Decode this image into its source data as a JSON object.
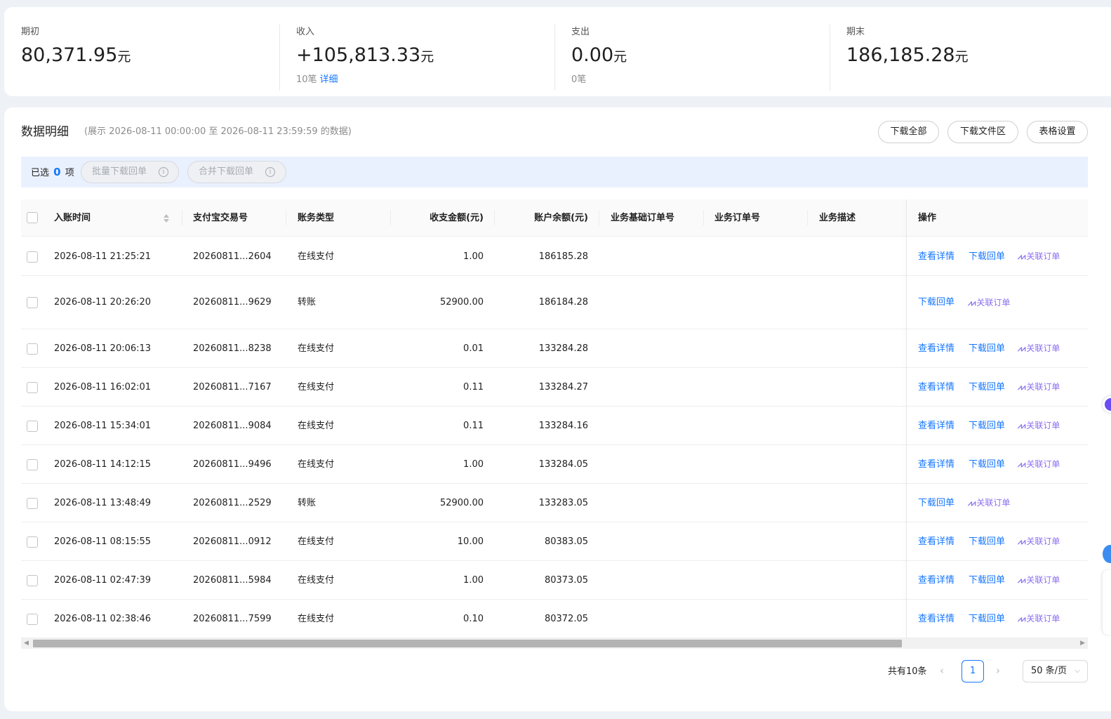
{
  "summary": {
    "opening": {
      "label": "期初",
      "value": "80,371.95",
      "unit": "元"
    },
    "income": {
      "label": "收入",
      "value": "+105,813.33",
      "unit": "元",
      "count": "10笔",
      "detail_link": "详细"
    },
    "expense": {
      "label": "支出",
      "value": "0.00",
      "unit": "元",
      "count": "0笔"
    },
    "closing": {
      "label": "期末",
      "value": "186,185.28",
      "unit": "元"
    }
  },
  "detail": {
    "title": "数据明细",
    "range": "(展示 2026-08-11 00:00:00 至 2026-08-11 23:59:59 的数据)",
    "buttons": {
      "download_all": "下载全部",
      "download_files": "下载文件区",
      "table_settings": "表格设置"
    }
  },
  "selection": {
    "prefix": "已选",
    "count": "0",
    "suffix": "项",
    "batch_download": "批量下载回单",
    "merge_download": "合并下载回单"
  },
  "table": {
    "columns": {
      "time": "入账时间",
      "trade_no": "支付宝交易号",
      "type": "账务类型",
      "amount": "收支金额(元)",
      "balance": "账户余额(元)",
      "base_order": "业务基础订单号",
      "order": "业务订单号",
      "desc": "业务描述",
      "ops": "操作"
    },
    "ops_labels": {
      "view": "查看详情",
      "download": "下载回单",
      "link_order": "关联订单"
    },
    "rows": [
      {
        "time": "2026-08-11 21:25:21",
        "trade_no": "20260811...2604",
        "type": "在线支付",
        "amount": "1.00",
        "balance": "186185.28",
        "has_view": true
      },
      {
        "time": "2026-08-11 20:26:20",
        "trade_no": "20260811...9629",
        "type": "转账",
        "amount": "52900.00",
        "balance": "186184.28",
        "has_view": false
      },
      {
        "time": "2026-08-11 20:06:13",
        "trade_no": "20260811...8238",
        "type": "在线支付",
        "amount": "0.01",
        "balance": "133284.28",
        "has_view": true
      },
      {
        "time": "2026-08-11 16:02:01",
        "trade_no": "20260811...7167",
        "type": "在线支付",
        "amount": "0.11",
        "balance": "133284.27",
        "has_view": true
      },
      {
        "time": "2026-08-11 15:34:01",
        "trade_no": "20260811...9084",
        "type": "在线支付",
        "amount": "0.11",
        "balance": "133284.16",
        "has_view": true
      },
      {
        "time": "2026-08-11 14:12:15",
        "trade_no": "20260811...9496",
        "type": "在线支付",
        "amount": "1.00",
        "balance": "133284.05",
        "has_view": true
      },
      {
        "time": "2026-08-11 13:48:49",
        "trade_no": "20260811...2529",
        "type": "转账",
        "amount": "52900.00",
        "balance": "133283.05",
        "has_view": false
      },
      {
        "time": "2026-08-11 08:15:55",
        "trade_no": "20260811...0912",
        "type": "在线支付",
        "amount": "10.00",
        "balance": "80383.05",
        "has_view": true
      },
      {
        "time": "2026-08-11 02:47:39",
        "trade_no": "20260811...5984",
        "type": "在线支付",
        "amount": "1.00",
        "balance": "80373.05",
        "has_view": true
      },
      {
        "time": "2026-08-11 02:38:46",
        "trade_no": "20260811...7599",
        "type": "在线支付",
        "amount": "0.10",
        "balance": "80372.05",
        "has_view": true
      }
    ]
  },
  "pagination": {
    "total": "共有10条",
    "page": "1",
    "page_size": "50 条/页"
  },
  "colors": {
    "accent": "#1677ff",
    "ai": "#8c6ff0",
    "selection_bg": "#eaf1fe"
  },
  "icons": {
    "sort": "sort-icon",
    "info": "info-icon",
    "ai": "ai-icon",
    "prev": "chevron-left-icon",
    "next": "chevron-right-icon",
    "dropdown": "chevron-down-icon"
  }
}
